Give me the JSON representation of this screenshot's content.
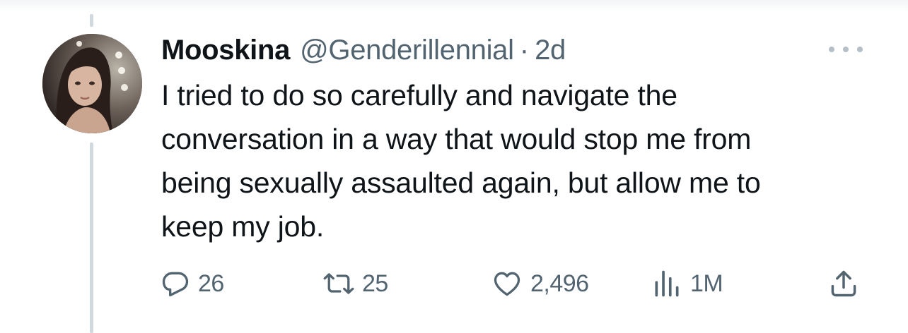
{
  "tweet": {
    "display_name": "Mooskina",
    "handle": "@Genderillennial",
    "separator": "·",
    "timestamp": "2d",
    "text": "I tried to do so carefully and navigate the conversation in a way that would stop me from being sexually assaulted again, but allow me to keep my job."
  },
  "actions": {
    "reply_count": "26",
    "retweet_count": "25",
    "like_count": "2,496",
    "views_count": "1M"
  },
  "icons": {
    "reply": "reply-icon",
    "retweet": "retweet-icon",
    "like": "heart-icon",
    "views": "views-bar-chart-icon",
    "share": "share-icon",
    "more": "more-options-icon"
  },
  "colors": {
    "text_primary": "#0f1419",
    "text_secondary": "#536471",
    "thread_line": "#cfd9de"
  }
}
